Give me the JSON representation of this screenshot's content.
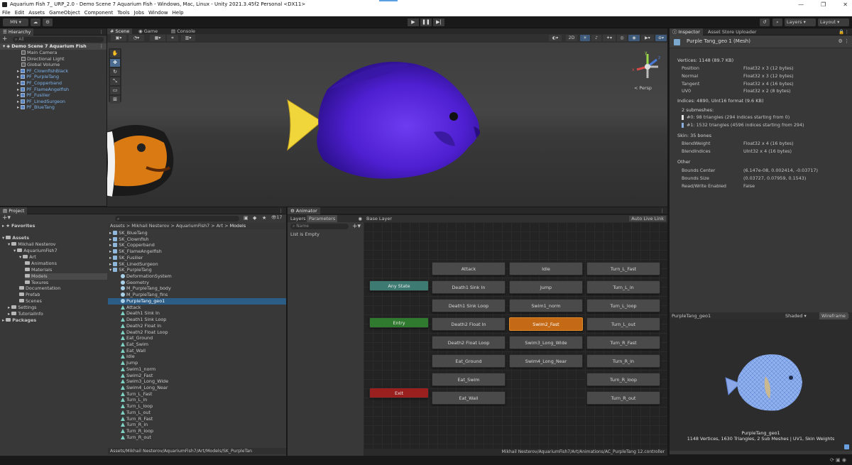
{
  "window": {
    "title": "Aquarium Fish 7_ URP_2.0 - Demo Scene 7 Aquarium Fish - Windows, Mac, Linux - Unity 2021.3.45f2 Personal <DX11>",
    "controls": [
      "—",
      "❐",
      "✕"
    ]
  },
  "menu": [
    "File",
    "Edit",
    "Assets",
    "GameObject",
    "Component",
    "Tools",
    "Jobs",
    "Window",
    "Help"
  ],
  "toolbar": {
    "account": "MN ▾",
    "layers": "Layers",
    "layout": "Layout"
  },
  "hierarchy": {
    "tab": "Hierarchy",
    "search_placeholder": "All",
    "scene": "Demo Scene 7 Aquarium Fish",
    "items": [
      {
        "label": "Main Camera",
        "prefab": false
      },
      {
        "label": "Directional Light",
        "prefab": false
      },
      {
        "label": "Global Volume",
        "prefab": false
      },
      {
        "label": "PF_ClownfishBlack",
        "prefab": true
      },
      {
        "label": "PF_PurpleTang",
        "prefab": true
      },
      {
        "label": "PF_Copperband",
        "prefab": true
      },
      {
        "label": "PF_FlameAngelfish",
        "prefab": true
      },
      {
        "label": "PF_Fusilier",
        "prefab": true
      },
      {
        "label": "PF_LinedSurgeon",
        "prefab": true
      },
      {
        "label": "PF_BlueTang",
        "prefab": true
      }
    ]
  },
  "scene_view": {
    "tabs": [
      "Scene",
      "Game",
      "Console"
    ],
    "toggle_2d": "2D",
    "persp": "< Persp",
    "axes": {
      "x": "x",
      "y": "y",
      "z": "z"
    }
  },
  "project": {
    "tab": "Project",
    "count": "17",
    "tree": [
      {
        "label": "Favorites",
        "depth": 0
      },
      {
        "label": "Assets",
        "depth": 0
      },
      {
        "label": "Mikhail Nesterov",
        "depth": 1
      },
      {
        "label": "AquariumFish7",
        "depth": 2
      },
      {
        "label": "Art",
        "depth": 3
      },
      {
        "label": "Animations",
        "depth": 4
      },
      {
        "label": "Materials",
        "depth": 4
      },
      {
        "label": "Models",
        "depth": 4
      },
      {
        "label": "Texures",
        "depth": 4
      },
      {
        "label": "Documentation",
        "depth": 3
      },
      {
        "label": "Prefab",
        "depth": 3
      },
      {
        "label": "Scenes",
        "depth": 3
      },
      {
        "label": "Settings",
        "depth": 1
      },
      {
        "label": "TutorialInfo",
        "depth": 1
      },
      {
        "label": "Packages",
        "depth": 0
      }
    ],
    "breadcrumb": [
      "Assets",
      "Mikhail Nesterov",
      "AquariumFish7",
      "Art",
      "Models"
    ],
    "files": [
      {
        "label": "SK_BlueTang",
        "kind": "model",
        "indent": 0
      },
      {
        "label": "SK_Clownfish",
        "kind": "model",
        "indent": 0
      },
      {
        "label": "SK_Copperband",
        "kind": "model",
        "indent": 0
      },
      {
        "label": "SK_FlameAngelfish",
        "kind": "model",
        "indent": 0
      },
      {
        "label": "SK_Fusilier",
        "kind": "model",
        "indent": 0
      },
      {
        "label": "SK_LinedSurgeon",
        "kind": "model",
        "indent": 0
      },
      {
        "label": "SK_PurpleTang",
        "kind": "model",
        "indent": 0
      },
      {
        "label": "DeformationSystem",
        "kind": "mesh",
        "indent": 1
      },
      {
        "label": "Geometry",
        "kind": "mesh",
        "indent": 1
      },
      {
        "label": "M_PurpleTang_body",
        "kind": "mesh",
        "indent": 1
      },
      {
        "label": "M_PurpleTang_fins",
        "kind": "mesh",
        "indent": 1
      },
      {
        "label": "PurpleTang_geo1",
        "kind": "mesh",
        "indent": 1,
        "selected": true
      },
      {
        "label": "Attack",
        "kind": "anim",
        "indent": 1
      },
      {
        "label": "Death1 Sink In",
        "kind": "anim",
        "indent": 1
      },
      {
        "label": "Death1 Sink Loop",
        "kind": "anim",
        "indent": 1
      },
      {
        "label": "Death2 Float In",
        "kind": "anim",
        "indent": 1
      },
      {
        "label": "Death2 Float Loop",
        "kind": "anim",
        "indent": 1
      },
      {
        "label": "Eat_Ground",
        "kind": "anim",
        "indent": 1
      },
      {
        "label": "Eat_Swim",
        "kind": "anim",
        "indent": 1
      },
      {
        "label": "Eat_Wall",
        "kind": "anim",
        "indent": 1
      },
      {
        "label": "Idle",
        "kind": "anim",
        "indent": 1
      },
      {
        "label": "Jump",
        "kind": "anim",
        "indent": 1
      },
      {
        "label": "Swim1_norm",
        "kind": "anim",
        "indent": 1
      },
      {
        "label": "Swim2_Fast",
        "kind": "anim",
        "indent": 1
      },
      {
        "label": "Swim3_Long_Wide",
        "kind": "anim",
        "indent": 1
      },
      {
        "label": "Swim4_Long_Near",
        "kind": "anim",
        "indent": 1
      },
      {
        "label": "Turn_L_Fast",
        "kind": "anim",
        "indent": 1
      },
      {
        "label": "Turn_L_in",
        "kind": "anim",
        "indent": 1
      },
      {
        "label": "Turn_L_loop",
        "kind": "anim",
        "indent": 1
      },
      {
        "label": "Turn_L_out",
        "kind": "anim",
        "indent": 1
      },
      {
        "label": "Turn_R_Fast",
        "kind": "anim",
        "indent": 1
      },
      {
        "label": "Turn_R_in",
        "kind": "anim",
        "indent": 1
      },
      {
        "label": "Turn_R_loop",
        "kind": "anim",
        "indent": 1
      },
      {
        "label": "Turn_R_out",
        "kind": "anim",
        "indent": 1
      }
    ],
    "path": "Assets/Mikhail Nesterov/AquariumFish7/Art/Models/SK_PurpleTan"
  },
  "animator": {
    "tab": "Animator",
    "subtabs": [
      "Layers",
      "Parameters"
    ],
    "search_placeholder": "Name",
    "empty": "List is Empty",
    "layer": "Base Layer",
    "auto_live_link": "Auto Live Link",
    "status_path": "Mikhail Nesterov/AquariumFish7/Art/Animations/AC_PurpleTang 12.controller",
    "special": {
      "any": "Any State",
      "entry": "Entry",
      "exit": "Exit"
    },
    "col1": [
      "Attack",
      "Death1 Sink In",
      "Death1 Sink Loop",
      "Death2 Float In",
      "Death2 Float Loop",
      "Eat_Ground",
      "Eat_Swim",
      "Eat_Wall"
    ],
    "col2": [
      "Idle",
      "Jump",
      "Swim1_norm",
      "Swim2_Fast",
      "Swim3_Long_Wide",
      "Swim4_Long_Near"
    ],
    "col3": [
      "Turn_L_Fast",
      "Turn_L_in",
      "Turn_L_loop",
      "Turn_L_out",
      "Turn_R_Fast",
      "Turn_R_in",
      "Turn_R_loop",
      "Turn_R_out"
    ],
    "active_state": "Swim2_Fast"
  },
  "inspector": {
    "tabs": [
      "Inspector",
      "Asset Store Uploader"
    ],
    "object": "Purple Tang_geo 1 (Mesh)",
    "vertices_header": "Vertices: 1148 (89.7 KB)",
    "vertices": [
      {
        "k": "Position",
        "v": "Float32 x 3 (12 bytes)"
      },
      {
        "k": "Normal",
        "v": "Float32 x 3 (12 bytes)"
      },
      {
        "k": "Tangent",
        "v": "Float32 x 4 (16 bytes)"
      },
      {
        "k": "UV0",
        "v": "Float32 x 2 (8 bytes)"
      }
    ],
    "indices_header": "Indices: 4890, UInt16 format (9.6 KB)",
    "submeshes_label": "2 submeshes:",
    "submeshes": [
      "#0: 98 triangles (294 indices starting from 0)",
      "#1: 1532 triangles (4596 indices starting from 294)"
    ],
    "skin_header": "Skin: 35 bones",
    "skin": [
      {
        "k": "BlendWeight",
        "v": "Float32 x 4 (16 bytes)"
      },
      {
        "k": "BlendIndices",
        "v": "UInt32 x 4 (16 bytes)"
      }
    ],
    "other_header": "Other",
    "other": [
      {
        "k": "Bounds Center",
        "v": "(6.147e-08, 0.002414, -0.03717)"
      },
      {
        "k": "Bounds Size",
        "v": "(0.03727, 0.07959, 0.1543)"
      },
      {
        "k": "Read/Write Enabled",
        "v": "False"
      }
    ],
    "preview": {
      "name": "PurpleTang_geo1",
      "mode": "Shaded",
      "wireframe": "Wireframe",
      "caption_name": "PurpleTang_geo1",
      "caption_info": "1148 Vertices, 1630 Triangles, 2 Sub Meshes | UV1, Skin Weights"
    }
  }
}
